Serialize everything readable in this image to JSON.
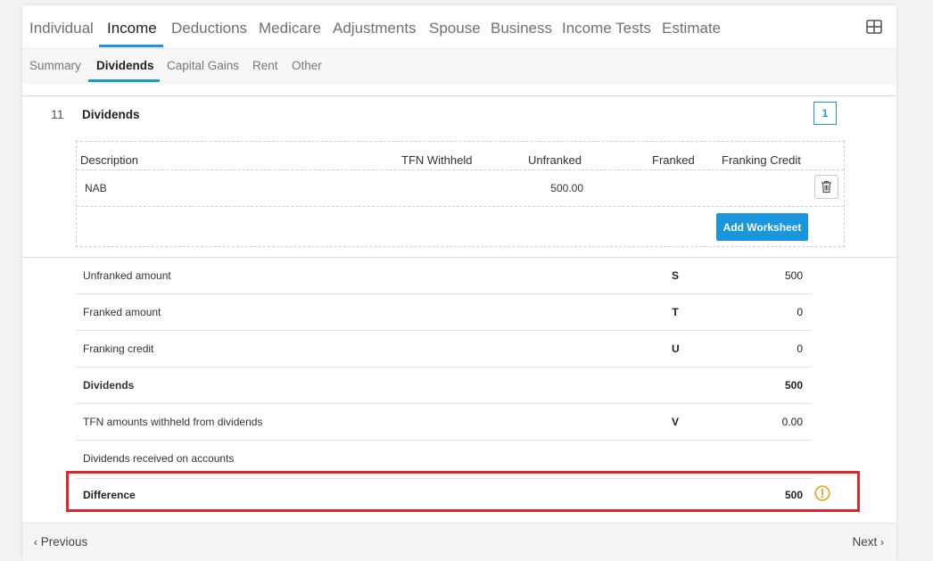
{
  "main_tabs": [
    {
      "label": "Individual"
    },
    {
      "label": "Income"
    },
    {
      "label": "Deductions"
    },
    {
      "label": "Medicare"
    },
    {
      "label": "Adjustments"
    },
    {
      "label": "Spouse"
    },
    {
      "label": "Business"
    },
    {
      "label": "Income Tests"
    },
    {
      "label": "Estimate"
    }
  ],
  "sub_tabs": [
    {
      "label": "Summary"
    },
    {
      "label": "Dividends"
    },
    {
      "label": "Capital Gains"
    },
    {
      "label": "Rent"
    },
    {
      "label": "Other"
    }
  ],
  "section": {
    "number": "11",
    "title": "Dividends",
    "count": "1"
  },
  "worksheet": {
    "headers": {
      "description": "Description",
      "tfn_withheld": "TFN Withheld",
      "unfranked": "Unfranked",
      "franked": "Franked",
      "franking_credit": "Franking Credit"
    },
    "rows": [
      {
        "description": "NAB",
        "tfn_withheld": "",
        "unfranked": "500.00",
        "franked": "",
        "franking_credit": ""
      }
    ],
    "add_button": "Add Worksheet"
  },
  "summary": [
    {
      "label": "Unfranked amount",
      "code": "S",
      "value": "500"
    },
    {
      "label": "Franked amount",
      "code": "T",
      "value": "0"
    },
    {
      "label": "Franking credit",
      "code": "U",
      "value": "0"
    },
    {
      "label": "Dividends",
      "code": "",
      "value": "500"
    },
    {
      "label": "TFN amounts withheld from dividends",
      "code": "V",
      "value": "0.00"
    },
    {
      "label": "Dividends received on accounts",
      "code": "",
      "value": ""
    }
  ],
  "difference": {
    "label": "Difference",
    "value": "500"
  },
  "footer": {
    "previous": "Previous",
    "next": "Next"
  },
  "colors": {
    "accent": "#1a96df",
    "highlight": "#e0262b",
    "warning": "#e8a317"
  },
  "icons": {
    "layout": "grid-layout-icon",
    "delete": "trash-icon",
    "warning": "warning-circle-icon",
    "prev": "chevron-left-icon",
    "next": "chevron-right-icon"
  }
}
